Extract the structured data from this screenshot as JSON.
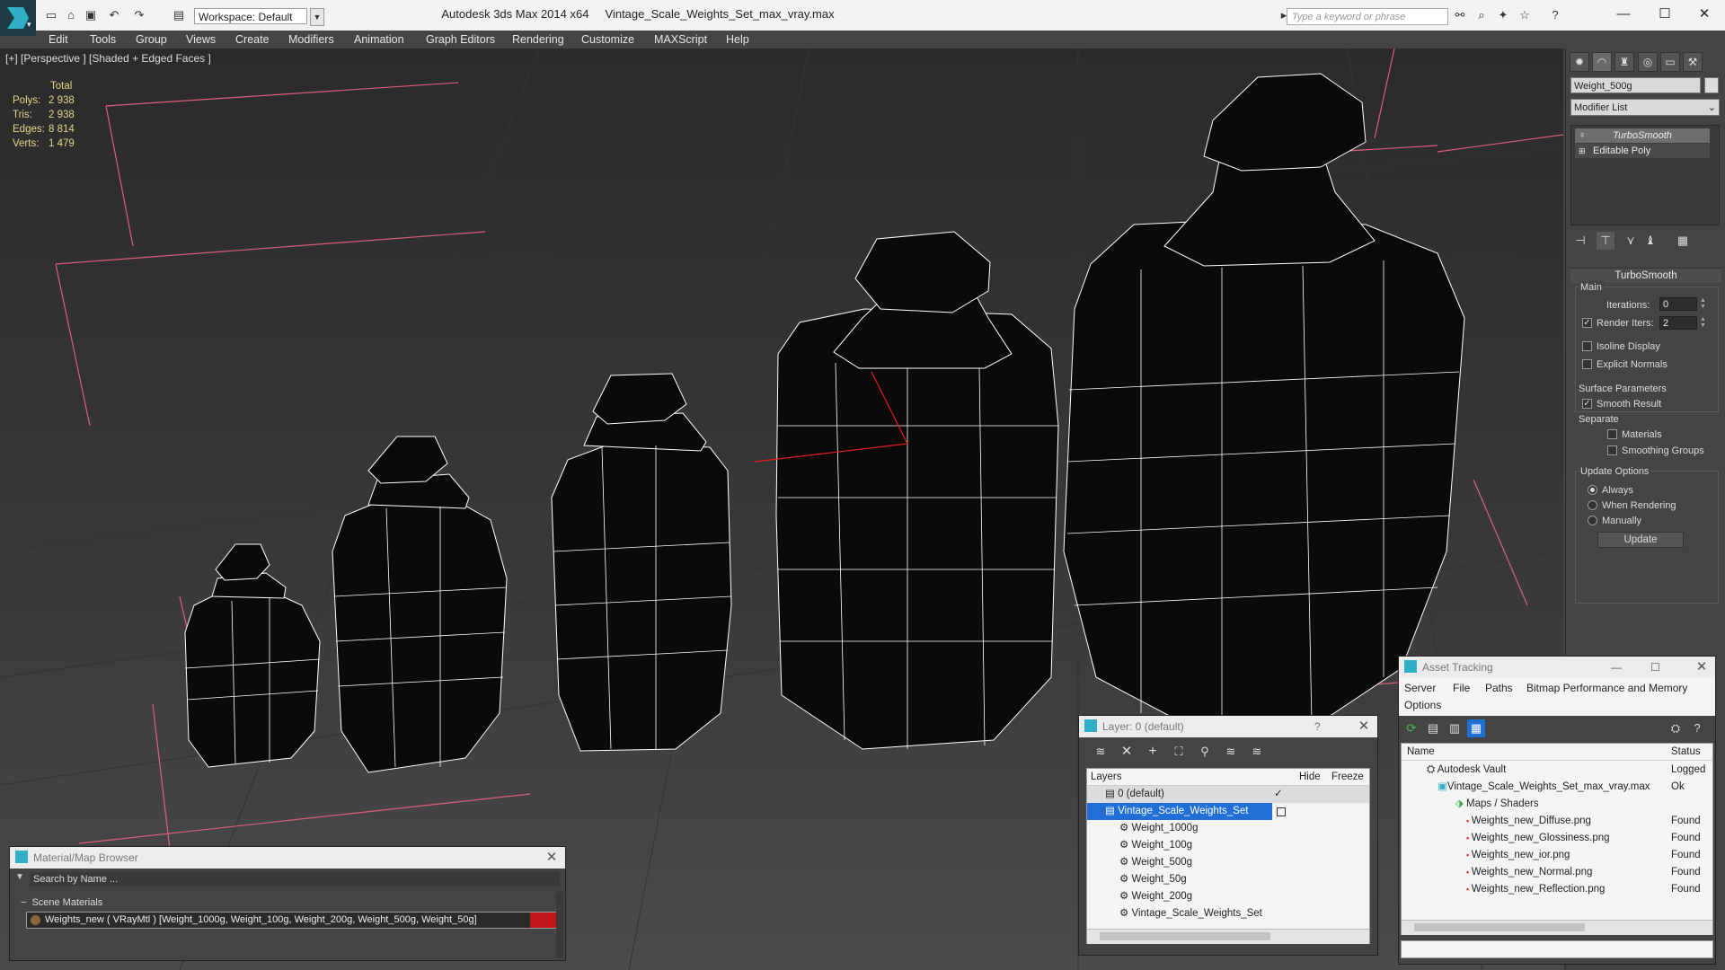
{
  "title": {
    "app": "Autodesk 3ds Max  2014 x64",
    "file": "Vintage_Scale_Weights_Set_max_vray.max"
  },
  "workspace": {
    "label": "Workspace: Default"
  },
  "search": {
    "placeholder": "Type a keyword or phrase"
  },
  "menu": [
    "Edit",
    "Tools",
    "Group",
    "Views",
    "Create",
    "Modifiers",
    "Animation",
    "Graph Editors",
    "Rendering",
    "Customize",
    "MAXScript",
    "Help"
  ],
  "viewport": {
    "label": "[+] [Perspective ] [Shaded + Edged Faces ]",
    "stats": {
      "header": "Total",
      "rows": [
        {
          "label": "Polys:",
          "value": "2 938"
        },
        {
          "label": "Tris:",
          "value": "2 938"
        },
        {
          "label": "Edges:",
          "value": "8 814"
        },
        {
          "label": "Verts:",
          "value": "1 479"
        }
      ]
    }
  },
  "command_panel": {
    "object_name": "Weight_500g",
    "modifier_list": "Modifier List",
    "stack": [
      "TurboSmooth",
      "Editable Poly"
    ],
    "rollout": "TurboSmooth",
    "main": "Main",
    "iterations_label": "Iterations:",
    "iterations": "0",
    "render_iters_label": "Render Iters:",
    "render_iters": "2",
    "isoline": "Isoline Display",
    "explicit_normals": "Explicit Normals",
    "surface_params": "Surface Parameters",
    "smooth_result": "Smooth Result",
    "separate": "Separate",
    "materials": "Materials",
    "smoothing_groups": "Smoothing Groups",
    "update_options": "Update Options",
    "always": "Always",
    "when_rendering": "When Rendering",
    "manually": "Manually",
    "update_btn": "Update"
  },
  "layer_window": {
    "title": "Layer: 0 (default)",
    "help": "?",
    "col_layers": "Layers",
    "col_hide": "Hide",
    "col_freeze": "Freeze",
    "rows": [
      "0 (default)",
      "Vintage_Scale_Weights_Set",
      "Weight_1000g",
      "Weight_100g",
      "Weight_500g",
      "Weight_50g",
      "Weight_200g",
      "Vintage_Scale_Weights_Set"
    ]
  },
  "asset_window": {
    "title": "Asset Tracking",
    "menu": [
      "Server",
      "File",
      "Paths",
      "Bitmap Performance and Memory",
      "Options"
    ],
    "col_name": "Name",
    "col_status": "Status",
    "rows": [
      {
        "name": "Autodesk Vault",
        "status": "Logged"
      },
      {
        "name": "Vintage_Scale_Weights_Set_max_vray.max",
        "status": "Ok"
      },
      {
        "name": "Maps / Shaders",
        "status": ""
      },
      {
        "name": "Weights_new_Diffuse.png",
        "status": "Found"
      },
      {
        "name": "Weights_new_Glossiness.png",
        "status": "Found"
      },
      {
        "name": "Weights_new_ior.png",
        "status": "Found"
      },
      {
        "name": "Weights_new_Normal.png",
        "status": "Found"
      },
      {
        "name": "Weights_new_Reflection.png",
        "status": "Found"
      }
    ]
  },
  "material_browser": {
    "title": "Material/Map Browser",
    "search_placeholder": "Search by Name ...",
    "section": "Scene Materials",
    "item": "Weights_new  ( VRayMtl )  [Weight_1000g, Weight_100g, Weight_200g, Weight_500g, Weight_50g]"
  },
  "colors": {
    "accent": "#1f6fd6",
    "found": "#222222",
    "wire": "#ffffff",
    "grid_pink": "#d9607a"
  }
}
